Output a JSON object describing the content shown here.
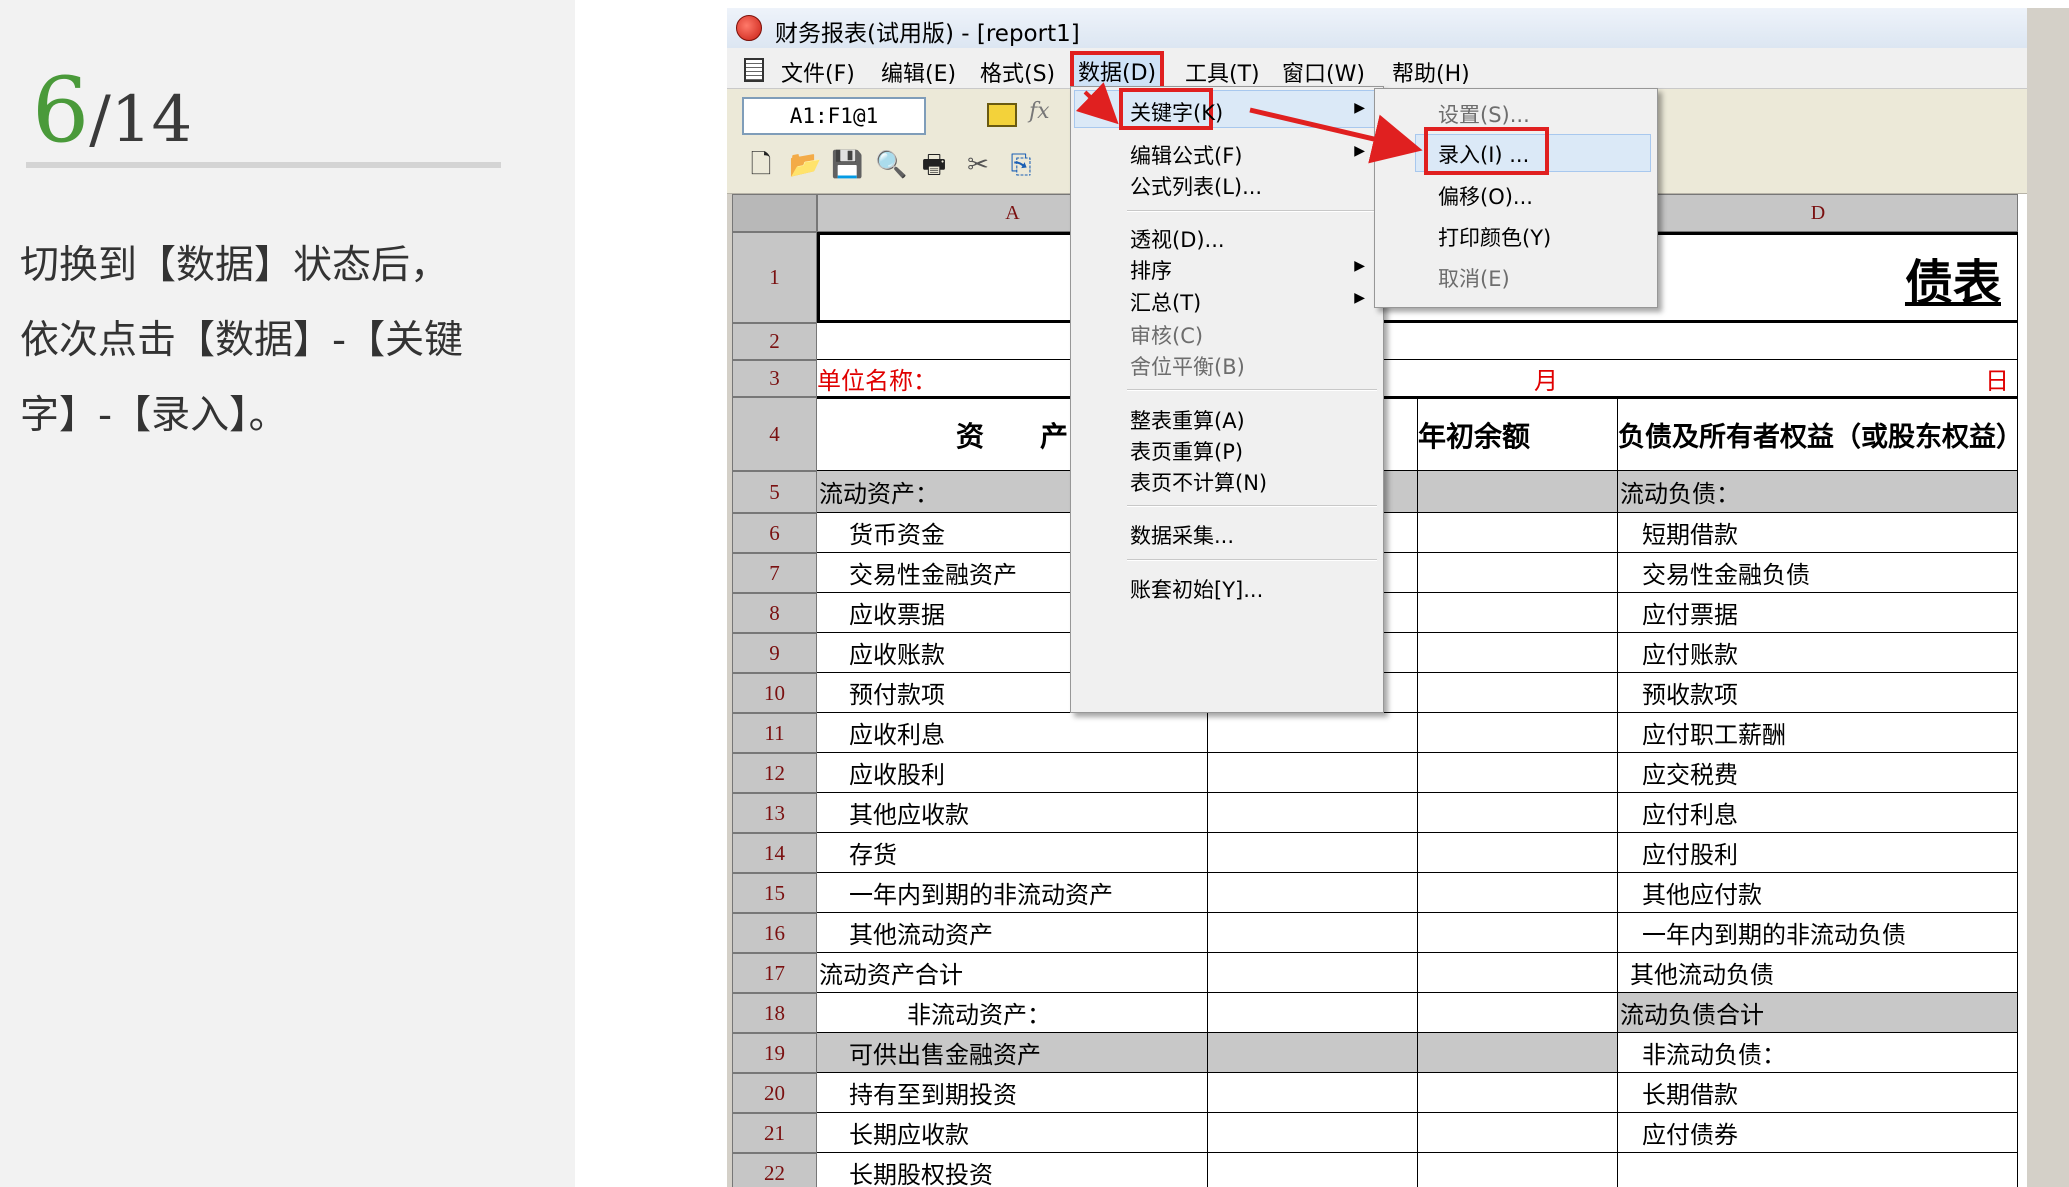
{
  "step": {
    "current": "6",
    "separator": "/",
    "total": "14"
  },
  "instruction": {
    "line1": "切换到【数据】状态后，",
    "line2": "依次点击【数据】-【关键",
    "line3": "字】-【录入】。"
  },
  "window": {
    "title": "财务报表(试用版) - [report1]"
  },
  "menu_bar": {
    "file": "文件(F)",
    "edit": "编辑(E)",
    "format": "格式(S)",
    "data": "数据(D)",
    "tools": "工具(T)",
    "window": "窗口(W)",
    "help": "帮助(H)"
  },
  "formula_bar": {
    "cell_ref": "A1:F1@1",
    "fx": "fx"
  },
  "toolbar": [
    "new-icon",
    "open-icon",
    "save-icon",
    "print-preview-icon",
    "print-icon",
    "cut-icon",
    "copy-icon"
  ],
  "columns": {
    "a": "A",
    "d": "D"
  },
  "rows": [
    "1",
    "2",
    "3",
    "4",
    "5",
    "6",
    "7",
    "8",
    "9",
    "10",
    "11",
    "12",
    "13",
    "14",
    "15",
    "16",
    "17",
    "18",
    "19",
    "20",
    "21",
    "22"
  ],
  "sheet": {
    "title_fragment": "债表",
    "unit_label": "单位名称：",
    "month": "月",
    "day": "日",
    "header_assets": "资　　产",
    "header_opening": "年初余额",
    "header_liabilities": "负债及所有者权益（或股东权益）",
    "left_items": [
      "流动资产：",
      "货币资金",
      "交易性金融资产",
      "应收票据",
      "应收账款",
      "预付款项",
      "应收利息",
      "应收股利",
      "其他应收款",
      "存货",
      "一年内到期的非流动资产",
      "其他流动资产",
      "流动资产合计",
      "非流动资产：",
      "可供出售金融资产",
      "持有至到期投资",
      "长期应收款",
      "长期股权投资"
    ],
    "right_items": [
      "流动负债：",
      "短期借款",
      "交易性金融负债",
      "应付票据",
      "应付账款",
      "预收款项",
      "应付职工薪酬",
      "应交税费",
      "应付利息",
      "应付股利",
      "其他应付款",
      "一年内到期的非流动负债",
      "其他流动负债",
      "流动负债合计",
      "非流动负债：",
      "长期借款",
      "应付债券",
      ""
    ]
  },
  "data_menu": {
    "keyword": "关键字(K)",
    "edit_formula": "编辑公式(F)",
    "formula_list": "公式列表(L)...",
    "perspective": "透视(D)...",
    "sort": "排序",
    "summary": "汇总(T)",
    "audit": "审核(C)",
    "balance": "舍位平衡(B)",
    "recalc_all": "整表重算(A)",
    "recalc_page": "表页重算(P)",
    "no_calc_page": "表页不计算(N)",
    "collect": "数据采集...",
    "account_init": "账套初始[Y]..."
  },
  "keyword_submenu": {
    "set": "设置(S)...",
    "enter": "录入(I) ...",
    "offset": "偏移(O)...",
    "print_color": "打印颜色(Y)",
    "cancel": "取消(E)"
  },
  "colors": {
    "highlight_red": "#e02020",
    "step_green": "#4a9a3a",
    "row_number": "#7a1010"
  }
}
